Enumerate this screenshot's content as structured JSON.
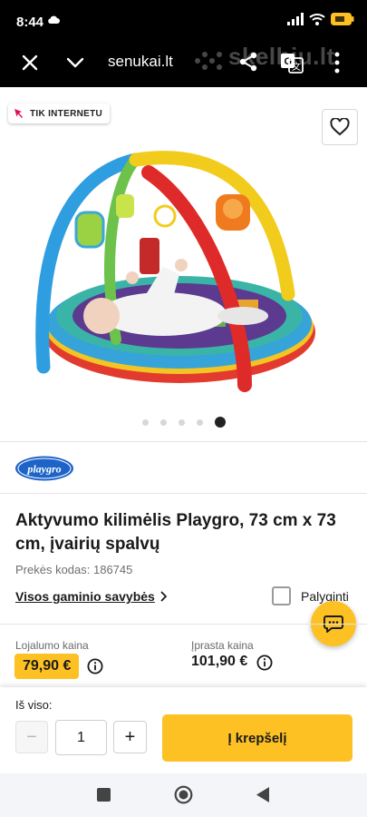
{
  "status_bar": {
    "time": "8:44",
    "icons": [
      "cloud-icon",
      "signal-icon",
      "wifi-icon",
      "battery-icon"
    ]
  },
  "browser": {
    "url": "senukai.lt",
    "watermark": "skelbiu.lt",
    "icons": [
      "close-icon",
      "chevron-down-icon",
      "share-icon",
      "translate-icon",
      "more-icon"
    ]
  },
  "product": {
    "badge": "TIK INTERNETU",
    "title": "Aktyvumo kilimėlis Playgro, 73 cm x 73 cm, įvairių spalvų",
    "code": "Prekės kodas: 186745",
    "attributes_link": "Visos gaminio savybės",
    "compare_label": "Palyginti",
    "gallery": {
      "slides": 5,
      "active_index": 4
    }
  },
  "brand": {
    "name": "playgro"
  },
  "prices": {
    "loyalty_label": "Lojalumo kaina",
    "loyalty_price": "79,90 €",
    "regular_label": "Įprasta kaina",
    "regular_price": "101,90 €"
  },
  "cart": {
    "total_label": "Iš viso:",
    "minus": "−",
    "quantity": "1",
    "plus": "+",
    "add_label": "Į krepšelį"
  },
  "colors": {
    "accent": "#fdc124",
    "status_bar": "#000000",
    "nav_bar": "#f4f5f9"
  },
  "nav": {
    "icons": [
      "recent-apps-icon",
      "home-icon",
      "back-icon"
    ]
  }
}
